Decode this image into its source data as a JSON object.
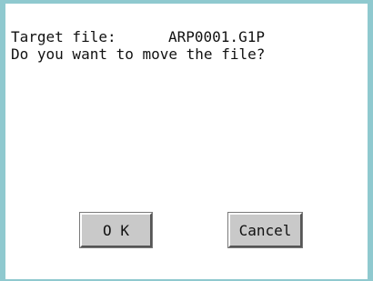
{
  "dialog": {
    "target_label": "Target file:",
    "target_value": "ARP0001.G1P",
    "question": "Do you want to move the file?",
    "ok_label": "O K",
    "cancel_label": "Cancel"
  },
  "colors": {
    "frame": "#8fc9cf",
    "button_face": "#c9c9c9",
    "background": "#ffffff"
  }
}
